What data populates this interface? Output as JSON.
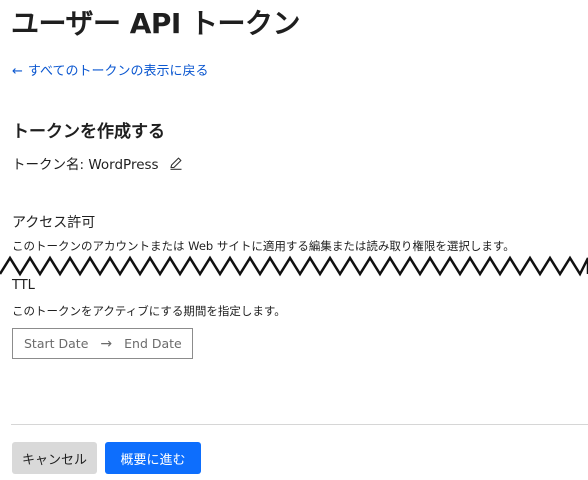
{
  "page": {
    "title": "ユーザー API トークン",
    "back_link": "すべてのトークンの表示に戻る"
  },
  "create": {
    "section_title": "トークンを作成する",
    "token_name": "トークン名: WordPress"
  },
  "access": {
    "label": "アクセス許可",
    "description": "このトークンのアカウントまたは Web サイトに適用する編集または読み取り権限を選択します。"
  },
  "ttl": {
    "label": "TTL",
    "description": "このトークンをアクティブにする期間を指定します。",
    "start_placeholder": "Start Date",
    "end_placeholder": "End Date"
  },
  "actions": {
    "cancel_label": "キャンセル",
    "next_label": "概要に進む"
  },
  "icons": {
    "back": "arrow-left-icon",
    "edit": "pencil-icon",
    "range": "arrow-right-icon"
  },
  "colors": {
    "link": "#0b57d0",
    "primary_button": "#0d6efd",
    "secondary_button": "#d9d9d9"
  }
}
